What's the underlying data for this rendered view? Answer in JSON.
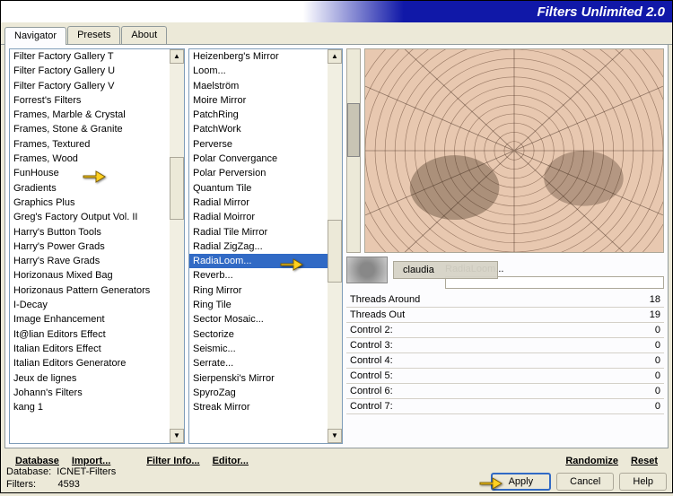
{
  "title": "Filters Unlimited 2.0",
  "tabs": {
    "navigator": "Navigator",
    "presets": "Presets",
    "about": "About"
  },
  "categories": [
    "Filter Factory Gallery T",
    "Filter Factory Gallery U",
    "Filter Factory Gallery V",
    "Forrest's Filters",
    "Frames, Marble & Crystal",
    "Frames, Stone & Granite",
    "Frames, Textured",
    "Frames, Wood",
    "FunHouse",
    "Gradients",
    "Graphics Plus",
    "Greg's Factory Output Vol. II",
    "Harry's Button Tools",
    "Harry's Power Grads",
    "Harry's Rave Grads",
    "Horizonaus Mixed Bag",
    "Horizonaus Pattern Generators",
    "I-Decay",
    "Image Enhancement",
    "It@lian Editors Effect",
    "Italian Editors Effect",
    "Italian Editors Generatore",
    "Jeux de lignes",
    "Johann's Filters",
    "kang 1"
  ],
  "filters": [
    "Heizenberg's Mirror",
    "Loom...",
    "Maelström",
    "Moire Mirror",
    "PatchRing",
    "PatchWork",
    "Perverse",
    "Polar Convergance",
    "Polar Perversion",
    "Quantum Tile",
    "Radial Mirror",
    "Radial Moirror",
    "Radial Tile Mirror",
    "Radial ZigZag...",
    "RadiaLoom...",
    "Reverb...",
    "Ring Mirror",
    "Ring Tile",
    "Sector Mosaic...",
    "Sectorize",
    "Seismic...",
    "Serrate...",
    "Sierpenski's Mirror",
    "SpyroZag",
    "Streak Mirror"
  ],
  "selected_filter_index": 14,
  "current_filter_name": "RadiaLoom...",
  "watermark": "claudia",
  "params": [
    {
      "label": "Threads Around",
      "value": "18"
    },
    {
      "label": "Threads Out",
      "value": "19"
    },
    {
      "label": "Control 2:",
      "value": "0"
    },
    {
      "label": "Control 3:",
      "value": "0"
    },
    {
      "label": "Control 4:",
      "value": "0"
    },
    {
      "label": "Control 5:",
      "value": "0"
    },
    {
      "label": "Control 6:",
      "value": "0"
    },
    {
      "label": "Control 7:",
      "value": "0"
    }
  ],
  "toolbar": {
    "database": "Database",
    "import": "Import...",
    "filter_info": "Filter Info...",
    "editor": "Editor...",
    "randomize": "Randomize",
    "reset": "Reset"
  },
  "actions": {
    "apply": "Apply",
    "cancel": "Cancel",
    "help": "Help"
  },
  "status": {
    "db_label": "Database:",
    "db_value": "ICNET-Filters",
    "filters_label": "Filters:",
    "filters_value": "4593"
  }
}
